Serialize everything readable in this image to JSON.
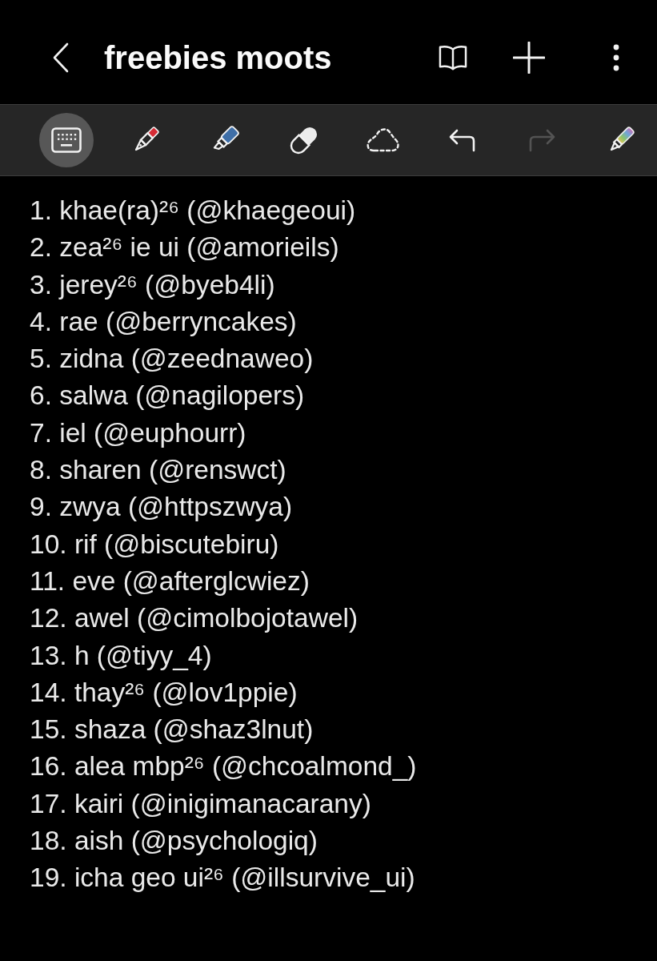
{
  "header": {
    "title": "freebies moots"
  },
  "toolbar": {
    "tools": [
      {
        "kind": "keyboard",
        "selected": true,
        "disabled": false
      },
      {
        "kind": "pen",
        "color": "#d62b35",
        "selected": false,
        "disabled": false
      },
      {
        "kind": "highlighter",
        "color": "#3f6fa8",
        "selected": false,
        "disabled": false
      },
      {
        "kind": "eraser",
        "selected": false,
        "disabled": false
      },
      {
        "kind": "lasso",
        "selected": false,
        "disabled": false
      },
      {
        "kind": "undo",
        "selected": false,
        "disabled": false
      },
      {
        "kind": "redo",
        "selected": false,
        "disabled": true
      },
      {
        "kind": "rainbow-pen",
        "selected": false,
        "disabled": false
      }
    ]
  },
  "note": {
    "lines": [
      "1. khae(ra)²⁶ (@khaegeoui)",
      "2. zea²⁶ ie ui (@amorieils)",
      "3. jerey²⁶ (@byeb4li)",
      "4. rae (@berryncakes)",
      "5. zidna (@zeednaweo)",
      "6. salwa (@nagilopers)",
      "7. iel (@euphourr)",
      "8. sharen (@renswct)",
      "9. zwya (@httpszwya)",
      "10. rif (@biscutebiru)",
      "11. eve (@afterglcwiez)",
      "12. awel (@cimolbojotawel)",
      "13. h (@tiyy_4)",
      "14. thay²⁶ (@lov1ppie)",
      "15. shaza (@shaz3lnut)",
      "16. alea mbp²⁶ (@chcoalmond_)",
      "17. kairi (@inigimanacarany)",
      "18. aish (@psychologiq)",
      "19. icha geo ui²⁶ (@illsurvive_ui)"
    ]
  }
}
